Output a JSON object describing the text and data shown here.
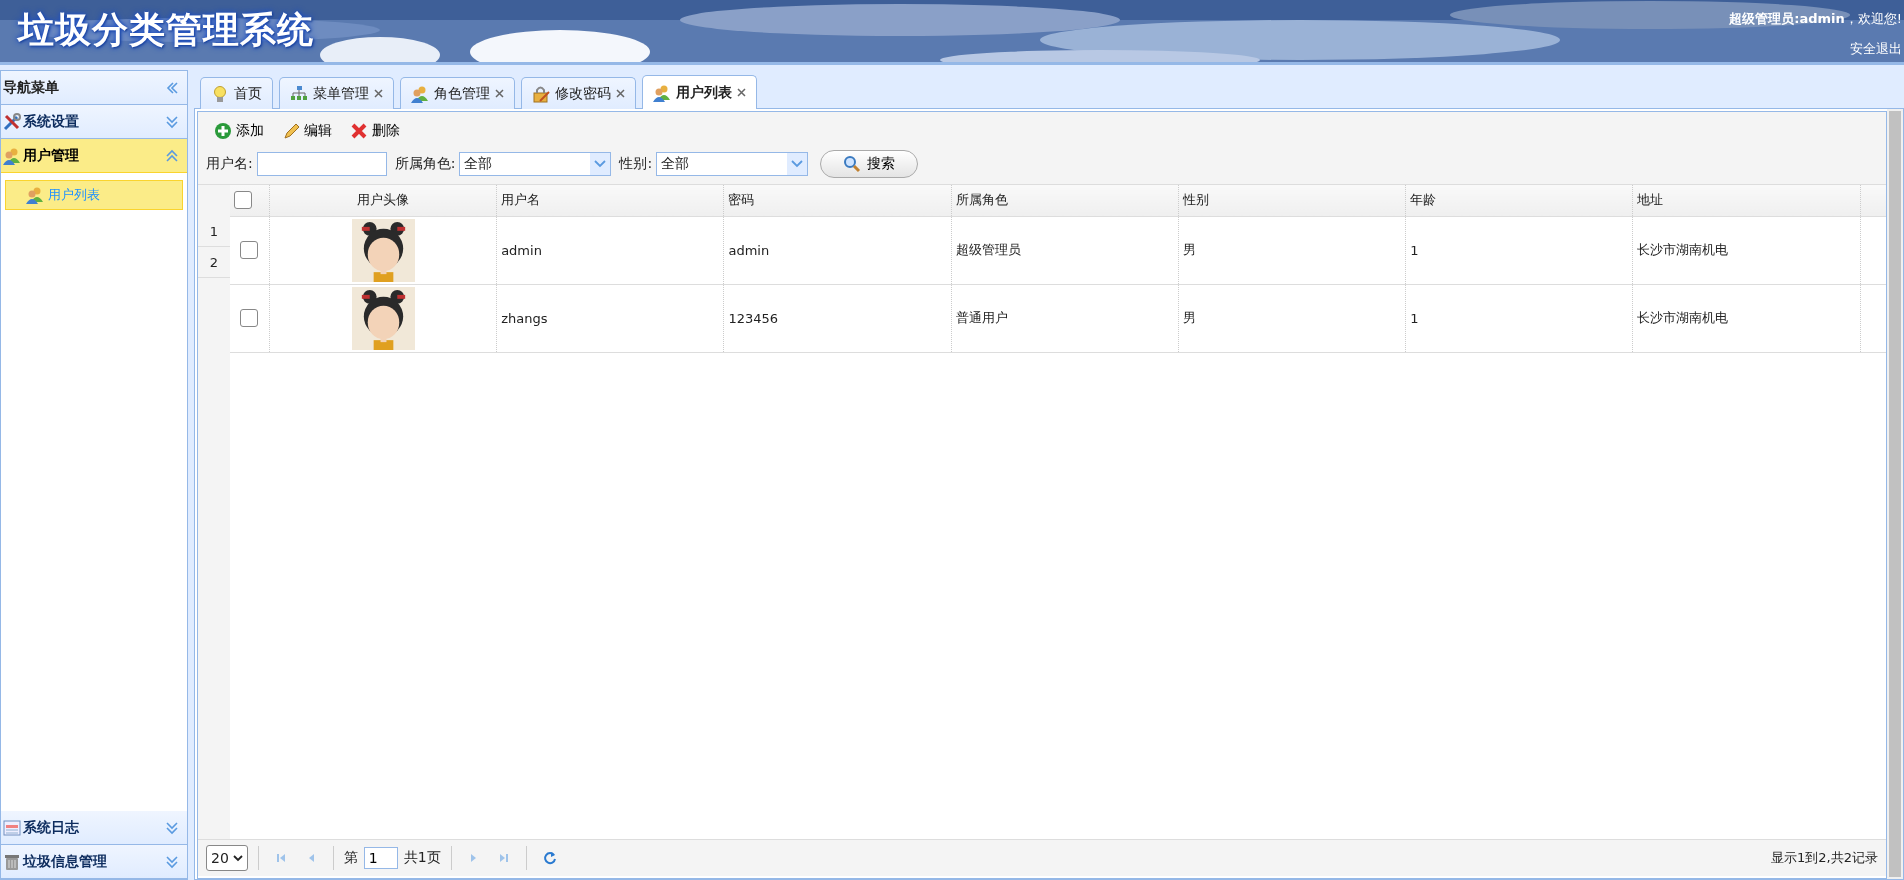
{
  "header": {
    "title": "垃圾分类管理系统",
    "welcome": "**超级管理员:admin**，欢迎您!",
    "logout": "安全退出"
  },
  "nav": {
    "title": "导航菜单",
    "sections": [
      {
        "label": "系统设置",
        "expanded": false
      },
      {
        "label": "用户管理",
        "expanded": true,
        "children": [
          {
            "label": "用户列表",
            "selected": true
          }
        ]
      },
      {
        "label": "系统日志",
        "expanded": false
      },
      {
        "label": "垃圾信息管理",
        "expanded": false
      }
    ]
  },
  "tabs": [
    {
      "label": "首页",
      "closable": false,
      "selected": false
    },
    {
      "label": "菜单管理",
      "closable": true,
      "selected": false
    },
    {
      "label": "角色管理",
      "closable": true,
      "selected": false
    },
    {
      "label": "修改密码",
      "closable": true,
      "selected": false
    },
    {
      "label": "用户列表",
      "closable": true,
      "selected": true
    }
  ],
  "toolbar": [
    {
      "kind": "add",
      "label": "添加"
    },
    {
      "kind": "edit",
      "label": "编辑"
    },
    {
      "kind": "delete",
      "label": "删除"
    }
  ],
  "search": {
    "username_label": "用户名:",
    "role_label": "所属角色:",
    "role_value": "全部",
    "gender_label": "性别:",
    "gender_value": "全部",
    "button": "搜索"
  },
  "table": {
    "all_checked": false,
    "columns": [
      "用户头像",
      "用户名",
      "密码",
      "所属角色",
      "性别",
      "年龄",
      "地址"
    ],
    "row_numbers": [
      "1",
      "2"
    ],
    "rows": [
      {
        "checked": false,
        "cells": [
          "",
          "admin",
          "admin",
          "超级管理员",
          "男",
          "1",
          "长沙市湖南机电"
        ]
      },
      {
        "checked": false,
        "cells": [
          "",
          "zhangs",
          "123456",
          "普通用户",
          "男",
          "1",
          "长沙市湖南机电"
        ]
      }
    ]
  },
  "pager": {
    "page_size": "20",
    "page_prefix": "第",
    "page": "1",
    "page_total": "共1页",
    "first_disabled": true,
    "next_disabled": true,
    "summary": "显示1到2,共2记录"
  }
}
